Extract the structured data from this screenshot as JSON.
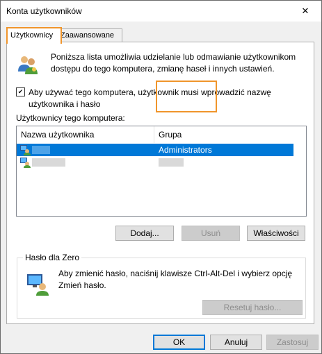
{
  "window": {
    "title": "Konta użytkowników",
    "close_glyph": "✕"
  },
  "tabs": [
    {
      "label": "Użytkownicy",
      "active": true
    },
    {
      "label": "Zaawansowane",
      "active": false
    }
  ],
  "intro_text": "Poniższa lista umożliwia udzielanie lub odmawianie użytkownikom dostępu do tego komputera, zmianę haseł i innych ustawień.",
  "require_login": {
    "checked": true,
    "check_glyph": "✔",
    "label": "Aby używać tego komputera, użytkownik musi wprowadzić nazwę użytkownika i hasło"
  },
  "users_list": {
    "label": "Użytkownicy tego komputera:",
    "columns": [
      "Nazwa użytkownika",
      "Grupa"
    ],
    "rows": [
      {
        "username": "",
        "group": "Administrators",
        "selected": true
      },
      {
        "username": "",
        "group": "",
        "selected": false
      }
    ]
  },
  "list_buttons": {
    "add": "Dodaj...",
    "remove": "Usuń",
    "properties": "Właściwości"
  },
  "password_group": {
    "title": "Hasło dla Zero",
    "text": "Aby zmienić hasło, naciśnij klawisze Ctrl-Alt-Del i wybierz opcję Zmień hasło.",
    "reset_button": "Resetuj hasło..."
  },
  "dialog_buttons": {
    "ok": "OK",
    "cancel": "Anuluj",
    "apply": "Zastosuj"
  },
  "colors": {
    "selection": "#0078d7",
    "highlight_outline": "#f0952b"
  }
}
